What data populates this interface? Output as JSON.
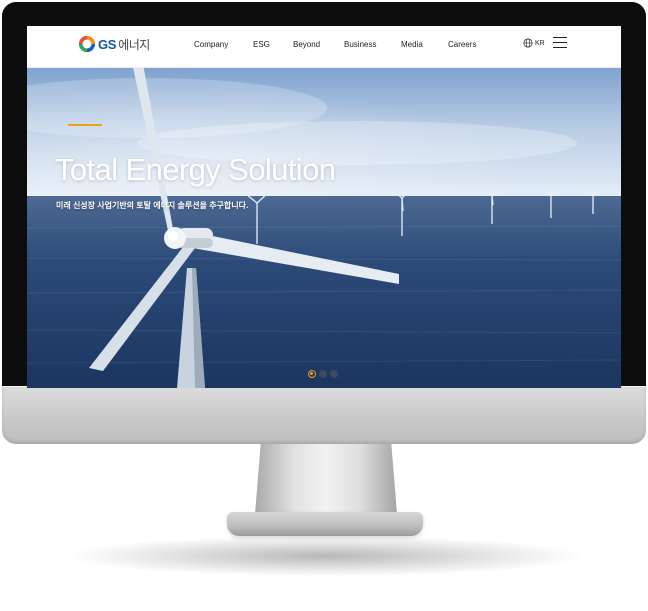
{
  "brand": {
    "logo_text": "GS",
    "logo_subtext": "에너지",
    "colors": {
      "blue": "#0f5aa8",
      "accent": "#e8a317"
    }
  },
  "nav": {
    "items": [
      {
        "label": "Company"
      },
      {
        "label": "ESG"
      },
      {
        "label": "Beyond"
      },
      {
        "label": "Business"
      },
      {
        "label": "Media"
      },
      {
        "label": "Careers"
      }
    ],
    "language": "KR",
    "language_icon": "globe-icon",
    "menu_icon": "hamburger-menu-icon"
  },
  "hero": {
    "title": "Total Energy Solution",
    "subtitle": "미래 신성장 사업기반의 토탈 에너지 솔루션을 추구합니다.",
    "slide_indicator": {
      "count": 3,
      "active": 1
    }
  }
}
